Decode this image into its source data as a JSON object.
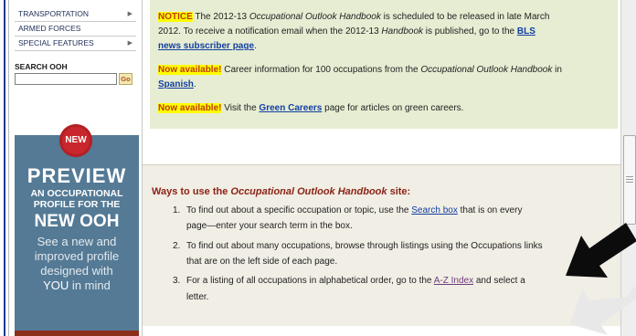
{
  "sidebar": {
    "nav_items": [
      {
        "label": "TRANSPORTATION",
        "has_arrow": true
      },
      {
        "label": "ARMED FORCES",
        "has_arrow": false
      },
      {
        "label": "SPECIAL FEATURES",
        "has_arrow": true
      }
    ],
    "search_label": "SEARCH OOH",
    "search_value": "",
    "go_label": "Go",
    "promo": {
      "badge": "NEW",
      "line1": "PREVIEW",
      "line2a": "AN OCCUPATIONAL",
      "line2b": "PROFILE FOR THE",
      "line3": "NEW OOH",
      "line4a": "See a new and",
      "line4b": "improved profile",
      "line4c": "designed with",
      "line4d": "YOU",
      "line4e": " in mind"
    }
  },
  "notice": {
    "badge": "NOTICE",
    "text1": " The 2012-13 ",
    "ooh_italic": "Occupational Outlook Handbook",
    "text2": " is scheduled to be released in late March",
    "text3": "2012. To receive a notification email when the 2012-13 ",
    "handbook_italic": "Handbook",
    "text4": " is published, go to the ",
    "bls_link": "BLS",
    "subscriber_link": "news subscriber page",
    "text5": ".",
    "available_badge": "Now available!",
    "spanish_text1": " Career information for 100 occupations from the ",
    "spanish_italic": "Occupational Outlook Handbook",
    "spanish_text2": " in",
    "spanish_link": "Spanish",
    "spanish_text3": ".",
    "green_text1": " Visit the ",
    "green_link": "Green Careers",
    "green_text2": " page for articles on green careers."
  },
  "ways": {
    "title_prefix": "Ways to use the ",
    "title_italic": "Occupational Outlook Handbook",
    "title_suffix": " site:",
    "item1_num": "1.",
    "item1_a": "To find out about a specific occupation or topic, use the ",
    "item1_link": "Search box",
    "item1_b": " that is on every",
    "item1_c": "page—enter your search term in the box.",
    "item2_num": "2.",
    "item2_a": "To find out about many occupations, browse through listings using the Occupations links",
    "item2_b": "that are on the left side of each page.",
    "item3_num": "3.",
    "item3_a": "For a listing of all occupations in alphabetical order, go to the ",
    "item3_link": "A-Z Index",
    "item3_b": " and select a",
    "item3_c": "letter."
  },
  "colors": {
    "notice_bg": "#e6edd2",
    "ways_bg": "#f1eee5",
    "promo_bg": "#547a95",
    "badge_red": "#c8282d",
    "link_blue": "#123ea3",
    "title_red": "#8b2316",
    "highlight_yellow": "#ffff00"
  },
  "icons": {
    "nav_arrow": "triangle-right-icon",
    "annotation": "pointer-arrow-icon"
  }
}
